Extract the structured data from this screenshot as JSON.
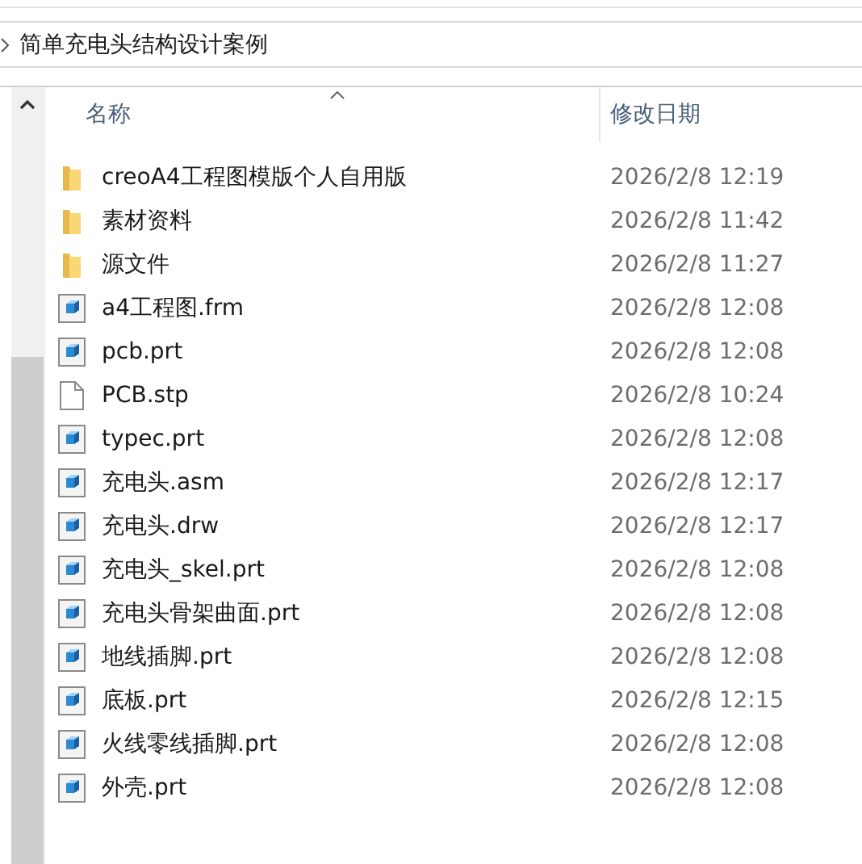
{
  "breadcrumb": {
    "path": "简单充电头结构设计案例"
  },
  "table": {
    "columns": [
      {
        "label": "名称",
        "sorted": true
      },
      {
        "label": "修改日期",
        "sorted": false
      }
    ],
    "rows": [
      {
        "name": "creoA4工程图模版个人自用版",
        "date": "2026/2/8 12:19",
        "kind": "folder"
      },
      {
        "name": "素材资料",
        "date": "2026/2/8 11:42",
        "kind": "folder"
      },
      {
        "name": "源文件",
        "date": "2026/2/8 11:27",
        "kind": "folder"
      },
      {
        "name": "a4工程图.frm",
        "date": "2026/2/8 12:08",
        "kind": "creo"
      },
      {
        "name": "pcb.prt",
        "date": "2026/2/8 12:08",
        "kind": "creo"
      },
      {
        "name": "PCB.stp",
        "date": "2026/2/8 10:24",
        "kind": "blank"
      },
      {
        "name": "typec.prt",
        "date": "2026/2/8 12:08",
        "kind": "creo"
      },
      {
        "name": "充电头.asm",
        "date": "2026/2/8 12:17",
        "kind": "creo"
      },
      {
        "name": "充电头.drw",
        "date": "2026/2/8 12:17",
        "kind": "creo"
      },
      {
        "name": "充电头_skel.prt",
        "date": "2026/2/8 12:08",
        "kind": "creo"
      },
      {
        "name": "充电头骨架曲面.prt",
        "date": "2026/2/8 12:08",
        "kind": "creo"
      },
      {
        "name": "地线插脚.prt",
        "date": "2026/2/8 12:08",
        "kind": "creo"
      },
      {
        "name": "底板.prt",
        "date": "2026/2/8 12:15",
        "kind": "creo"
      },
      {
        "name": "火线零线插脚.prt",
        "date": "2026/2/8 12:08",
        "kind": "creo"
      },
      {
        "name": "外壳.prt",
        "date": "2026/2/8 12:08",
        "kind": "creo"
      }
    ]
  }
}
